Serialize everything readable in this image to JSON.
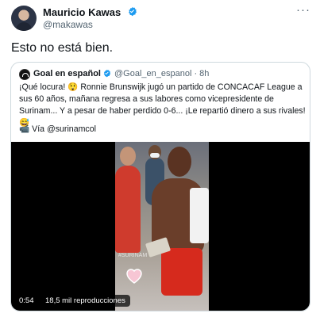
{
  "tweet": {
    "author_name": "Mauricio Kawas",
    "author_handle": "@makawas",
    "more_glyph": "···",
    "text": "Esto no está bien."
  },
  "quoted": {
    "author_name": "Goal en español",
    "author_handle": "@Goal_en_espanol · 8h",
    "text": "¡Qué locura! 😲 Ronnie Brunswijk jugó un partido de CONCACAF League a sus 60 años, mañana regresa a sus labores como vicepresidente de Surinam... Y a pesar de haber perdido 0-6... ¡Le repartió dinero a sus rivales! 😅",
    "credit": "📹 Vía @surinamcol"
  },
  "video": {
    "duration": "0:54",
    "views": "18,5 mil reproducciones",
    "sticker_text": "#SURINAM"
  },
  "colors": {
    "verified": "#1d9bf0",
    "text_primary": "#0f1419",
    "text_secondary": "#536471",
    "border": "#cfd9de"
  },
  "icons": {
    "verified": "verified-badge-icon",
    "more": "more-options-icon",
    "camera": "video-camera-emoji"
  }
}
